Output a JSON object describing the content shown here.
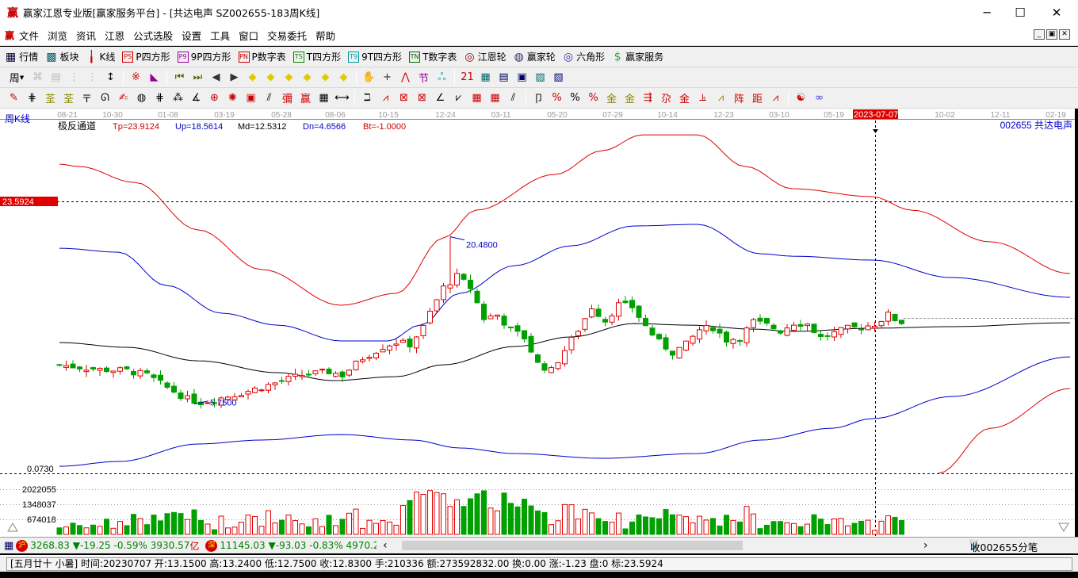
{
  "title": {
    "logo": "赢",
    "text": "赢家江恩专业版[赢家服务平台] - [共达电声  SZ002655-183周K线]"
  },
  "window": {
    "minimize": "─",
    "maximize": "☐",
    "close": "✕"
  },
  "menu": {
    "logo": "赢",
    "items": [
      "文件",
      "浏览",
      "资讯",
      "江恩",
      "公式选股",
      "设置",
      "工具",
      "窗口",
      "交易委托",
      "帮助"
    ],
    "mdi": [
      "_",
      "▣",
      "✕"
    ]
  },
  "toolbar1": [
    {
      "icon": "grid-icon",
      "glyph": "▦",
      "label": "行情",
      "color": "#003"
    },
    {
      "icon": "blocks-icon",
      "glyph": "▩",
      "label": "板块",
      "color": "#066"
    },
    {
      "icon": "kline-icon",
      "glyph": "╽",
      "label": "K线",
      "color": "#c00"
    },
    {
      "icon": "ps-icon",
      "glyph": "PS",
      "label": "P四方形",
      "color": "#c00"
    },
    {
      "icon": "p9-icon",
      "glyph": "P9",
      "label": "9P四方形",
      "color": "#909"
    },
    {
      "icon": "pn-icon",
      "glyph": "PN",
      "label": "P数字表",
      "color": "#c00"
    },
    {
      "icon": "ts-icon",
      "glyph": "TS",
      "label": "T四方形",
      "color": "#080"
    },
    {
      "icon": "t9-icon",
      "glyph": "T9",
      "label": "9T四方形",
      "color": "#099"
    },
    {
      "icon": "tn-icon",
      "glyph": "TN",
      "label": "T数字表",
      "color": "#060"
    },
    {
      "icon": "gann-wheel-icon",
      "glyph": "◎",
      "label": "江恩轮",
      "color": "#800"
    },
    {
      "icon": "winner-wheel-icon",
      "glyph": "◍",
      "label": "赢家轮",
      "color": "#336"
    },
    {
      "icon": "hexagon-icon",
      "glyph": "◎",
      "label": "六角形",
      "color": "#33a"
    },
    {
      "icon": "dollar-icon",
      "glyph": "$",
      "label": "赢家服务",
      "color": "#3a3"
    }
  ],
  "toolbar2": {
    "period": "周",
    "icons": [
      [
        "disabled-a-icon",
        "⌘",
        "#bbb"
      ],
      [
        "disabled-b-icon",
        "▤",
        "#bbb"
      ],
      [
        "disabled-c-icon",
        "⋮",
        "#bbb"
      ],
      [
        "disabled-d-icon",
        "⋮",
        "#bbb"
      ],
      [
        "cursor-dropdown-icon",
        "↕",
        "#000"
      ],
      [
        "|",
        ""
      ],
      [
        "pattern-icon",
        "※",
        "#c00"
      ],
      [
        "color-fan-icon",
        "◣",
        "#909"
      ],
      [
        "|",
        ""
      ],
      [
        "first-icon",
        "⏮",
        "#660"
      ],
      [
        "last-icon",
        "⏭",
        "#660"
      ],
      [
        "prev-icon",
        "◀",
        "#333"
      ],
      [
        "next-icon",
        "▶",
        "#333"
      ],
      [
        "diamond-1-icon",
        "◆",
        "#dc0"
      ],
      [
        "diamond-2-icon",
        "◆",
        "#dc0"
      ],
      [
        "diamond-3-icon",
        "◆",
        "#dc0"
      ],
      [
        "diamond-4-icon",
        "◆",
        "#dc0"
      ],
      [
        "diamond-5-icon",
        "◆",
        "#dc0"
      ],
      [
        "diamond-6-icon",
        "◆",
        "#dc0"
      ],
      [
        "|",
        ""
      ],
      [
        "hand-icon",
        "✋",
        "#333"
      ],
      [
        "crosshair-icon",
        "+",
        "#333"
      ],
      [
        "line-tool-icon",
        "⋀",
        "#c00"
      ],
      [
        "tool-icon",
        "节",
        "#909"
      ],
      [
        "tool2-icon",
        "ஃ",
        "#099"
      ],
      [
        "|",
        ""
      ],
      [
        "calendar-icon",
        "21",
        "#c00"
      ],
      [
        "calculator-icon",
        "▦",
        "#066"
      ],
      [
        "notes-icon",
        "▤",
        "#006"
      ],
      [
        "save-icon",
        "▣",
        "#006"
      ],
      [
        "network-icon",
        "▨",
        "#066"
      ],
      [
        "export-icon",
        "▧",
        "#006"
      ]
    ]
  },
  "toolbar3": {
    "icons": [
      [
        "pen-icon",
        "✎",
        "#c00"
      ],
      [
        "hash-icon",
        "⋕",
        "#000"
      ],
      [
        "gold-1-icon",
        "荃",
        "#880"
      ],
      [
        "gold-2-icon",
        "荃",
        "#880"
      ],
      [
        "t-icon",
        "〒",
        "#000"
      ],
      [
        "spiral-icon",
        "ᘏ",
        "#000"
      ],
      [
        "pen2-icon",
        "✍",
        "#c00"
      ],
      [
        "circle-icon",
        "◍",
        "#000"
      ],
      [
        "hash2-icon",
        "⋕",
        "#000"
      ],
      [
        "grid-n-icon",
        "⁂",
        "#000"
      ],
      [
        "angle-icon",
        "∡",
        "#000"
      ],
      [
        "target-icon",
        "⊕",
        "#c00"
      ],
      [
        "star-icon",
        "✺",
        "#c00"
      ],
      [
        "square-icon",
        "▣",
        "#c00"
      ],
      [
        "lines-icon",
        "⫽",
        "#000"
      ],
      [
        "red-tool-icon",
        "彌",
        "#c00"
      ],
      [
        "win-icon",
        "赢",
        "#c00"
      ],
      [
        "table-icon",
        "▦",
        "#000"
      ],
      [
        "width-icon",
        "⟷",
        "#000"
      ],
      [
        "|",
        ""
      ],
      [
        "bracket-icon",
        "ℶ",
        "#000"
      ],
      [
        "fan-icon",
        "⩘",
        "#c00"
      ],
      [
        "box-fan-icon",
        "⊠",
        "#c00"
      ],
      [
        "cross-box-icon",
        "⊠",
        "#c00"
      ],
      [
        "angle2-icon",
        "∠",
        "#000"
      ],
      [
        "v-icon",
        "⩗",
        "#000"
      ],
      [
        "grid-red-icon",
        "▦",
        "#c00"
      ],
      [
        "grid-red2-icon",
        "▦",
        "#c00"
      ],
      [
        "parallel-icon",
        "⫽",
        "#000"
      ],
      [
        "|",
        ""
      ],
      [
        "ruler-icon",
        "卩",
        "#000"
      ],
      [
        "percent-red-icon",
        "%",
        "#c00"
      ],
      [
        "percent-icon",
        "%",
        "#000"
      ],
      [
        "percent-lines-icon",
        "%",
        "#c00"
      ],
      [
        "coin-icon",
        "金",
        "#880"
      ],
      [
        "gold-lines-icon",
        "金",
        "#880"
      ],
      [
        "arrow-tool-icon",
        "⇶",
        "#c00"
      ],
      [
        "red-a-icon",
        "尕",
        "#c00"
      ],
      [
        "red-b-icon",
        "金",
        "#c00"
      ],
      [
        "fan2-icon",
        "⫡",
        "#c00"
      ],
      [
        "gold-fan-icon",
        "⩘",
        "#880"
      ],
      [
        "red-c-icon",
        "阵",
        "#c00"
      ],
      [
        "red-d-icon",
        "距",
        "#c00"
      ],
      [
        "fan3-icon",
        "⩘",
        "#c00"
      ],
      [
        "|",
        ""
      ],
      [
        "yinyang-icon",
        "☯",
        "#c00"
      ],
      [
        "infinity-icon",
        "∞",
        "#33c"
      ]
    ]
  },
  "chart": {
    "period_label": "周K线",
    "indicator": {
      "name": "极反通道",
      "tp": "Tp=23.9124",
      "up": "Up=18.5614",
      "md": "Md=12.5312",
      "dn": "Dn=4.6566",
      "bt": "Bt=-1.0000"
    },
    "stock": "002655  共达电声",
    "date_ticks": [
      "08-21",
      "10-30",
      "01-08",
      "03-19",
      "05-28",
      "08-06",
      "10-15",
      "12-24",
      "03-11",
      "05-20",
      "07-29",
      "10-14",
      "12-23",
      "03-10",
      "05-19",
      "",
      "10-02",
      "12-11",
      "02-19"
    ],
    "cursor_date": "2023-07-07",
    "cursor_price": "23.5924",
    "bottom_price": "0.0730",
    "high_label": "20.4800",
    "low_label": "5.7500",
    "volume_ticks": [
      "2022055",
      "1348037",
      "674018"
    ],
    "colors": {
      "up": "#e00000",
      "down": "#00a000",
      "upper_outer": "#e00000",
      "upper_inner": "#0000cc",
      "mid": "#000000",
      "lower_inner": "#0000cc",
      "lower_outer": "#e00000"
    }
  },
  "chart_data": {
    "type": "candlestick",
    "price_range": [
      0.073,
      23.5924
    ],
    "close_keypoints": [
      [
        0,
        9.2
      ],
      [
        3,
        9.0
      ],
      [
        6,
        8.8
      ],
      [
        10,
        8.7
      ],
      [
        13,
        8.3
      ],
      [
        16,
        7.2
      ],
      [
        19,
        6.2
      ],
      [
        21,
        5.9
      ],
      [
        24,
        6.3
      ],
      [
        28,
        6.9
      ],
      [
        32,
        7.6
      ],
      [
        36,
        8.3
      ],
      [
        40,
        8.6
      ],
      [
        42,
        8.3
      ],
      [
        45,
        9.8
      ],
      [
        48,
        10.8
      ],
      [
        50,
        11.2
      ],
      [
        52,
        11.0
      ],
      [
        54,
        12.5
      ],
      [
        55,
        13.8
      ],
      [
        57,
        16.0
      ],
      [
        59,
        17.0
      ],
      [
        61,
        16.0
      ],
      [
        63,
        13.3
      ],
      [
        65,
        13.6
      ],
      [
        67,
        12.3
      ],
      [
        69,
        11.6
      ],
      [
        71,
        9.3
      ],
      [
        73,
        8.7
      ],
      [
        75,
        10.5
      ],
      [
        77,
        12.3
      ],
      [
        79,
        14.3
      ],
      [
        81,
        13.1
      ],
      [
        83,
        14.5
      ],
      [
        85,
        14.3
      ],
      [
        87,
        12.6
      ],
      [
        89,
        11.2
      ],
      [
        91,
        10.3
      ],
      [
        93,
        11.0
      ],
      [
        95,
        12.3
      ],
      [
        97,
        12.5
      ],
      [
        99,
        11.4
      ],
      [
        101,
        11.6
      ],
      [
        103,
        13.0
      ],
      [
        105,
        12.7
      ],
      [
        107,
        12.2
      ],
      [
        109,
        12.9
      ],
      [
        111,
        12.8
      ],
      [
        113,
        11.6
      ],
      [
        115,
        12.0
      ],
      [
        117,
        12.4
      ],
      [
        119,
        12.5
      ],
      [
        121,
        12.8
      ],
      [
        123,
        13.6
      ],
      [
        125,
        12.83
      ]
    ],
    "high_point": [
      58,
      20.48
    ],
    "low_point": [
      20,
      5.75
    ],
    "bands": {
      "upper_outer": [
        [
          0,
          26.87
        ],
        [
          2.9,
          26.66
        ],
        [
          11.2,
          25.26
        ],
        [
          20.6,
          21.08
        ],
        [
          30,
          17.59
        ],
        [
          41.8,
          14.45
        ],
        [
          50,
          15.5
        ],
        [
          57,
          20.38
        ],
        [
          61.8,
          22.82
        ],
        [
          73.5,
          25.96
        ],
        [
          80.6,
          28.06
        ],
        [
          86.5,
          29.45
        ],
        [
          94.7,
          29.45
        ],
        [
          101.8,
          26.66
        ],
        [
          108.8,
          24.71
        ],
        [
          120.6,
          24.01
        ],
        [
          126.5,
          22.82
        ],
        [
          138.2,
          20.03
        ],
        [
          150,
          17.24
        ]
      ],
      "upper_inner": [
        [
          0,
          19.47
        ],
        [
          8.8,
          19.12
        ],
        [
          15.9,
          16.19
        ],
        [
          24.1,
          13.75
        ],
        [
          32.4,
          12.7
        ],
        [
          41.8,
          11.31
        ],
        [
          48.8,
          11.31
        ],
        [
          53.5,
          12.7
        ],
        [
          59.4,
          15.5
        ],
        [
          67.6,
          17.94
        ],
        [
          75.9,
          19.68
        ],
        [
          85.3,
          21.43
        ],
        [
          94.7,
          21.57
        ],
        [
          104.1,
          18.98
        ],
        [
          108.8,
          18.77
        ],
        [
          120.6,
          18.43
        ],
        [
          132.4,
          16.89
        ],
        [
          150,
          15.15
        ]
      ],
      "mid": [
        [
          0,
          11.17
        ],
        [
          10,
          10.75
        ],
        [
          20.6,
          9.56
        ],
        [
          32.4,
          8.52
        ],
        [
          40.6,
          7.82
        ],
        [
          50,
          8.17
        ],
        [
          57,
          9.21
        ],
        [
          67.6,
          10.82
        ],
        [
          75.9,
          11.66
        ],
        [
          85.3,
          12.84
        ],
        [
          93.5,
          12.7
        ],
        [
          102.9,
          12.35
        ],
        [
          108.8,
          12.15
        ],
        [
          120.6,
          12.43
        ],
        [
          132.4,
          12.57
        ],
        [
          150,
          12.91
        ]
      ],
      "lower_inner": [
        [
          0,
          0.28
        ],
        [
          8.8,
          0.7
        ],
        [
          20.6,
          2.24
        ],
        [
          30,
          2.59
        ],
        [
          41.8,
          3.07
        ],
        [
          52.4,
          2.59
        ],
        [
          59.4,
          1.89
        ],
        [
          67.6,
          1.4
        ],
        [
          80.6,
          0.98
        ],
        [
          94.7,
          1.4
        ],
        [
          104.1,
          2.59
        ],
        [
          114.7,
          3.63
        ],
        [
          120.6,
          4.47
        ],
        [
          132.4,
          6.42
        ],
        [
          150,
          9.91
        ]
      ],
      "lower_outer": [
        [
          130.4,
          -0.35
        ],
        [
          138.2,
          3.63
        ],
        [
          150,
          7.12
        ]
      ]
    },
    "volume_max": 2700000
  },
  "bottombar": {
    "sh": {
      "badge": "沪",
      "value": "3268.83",
      "change": "▼-19.25",
      "pct": "-0.59%",
      "amount": "3930.57",
      "unit": "亿"
    },
    "sz": {
      "badge": "深",
      "value": "11145.03",
      "change": "▼-93.03",
      "pct": "-0.83%",
      "amount": "4970.20"
    },
    "scroll_left": "‹",
    "scroll_right": "›",
    "feed": "收002655分笔"
  },
  "status": "[五月廿十 小暑] 时间:20230707 开:13.1500 高:13.2400 低:12.7500 收:12.8300 手:210336 额:273592832.00 换:0.00 涨:-1.23 盘:0 标:23.5924"
}
